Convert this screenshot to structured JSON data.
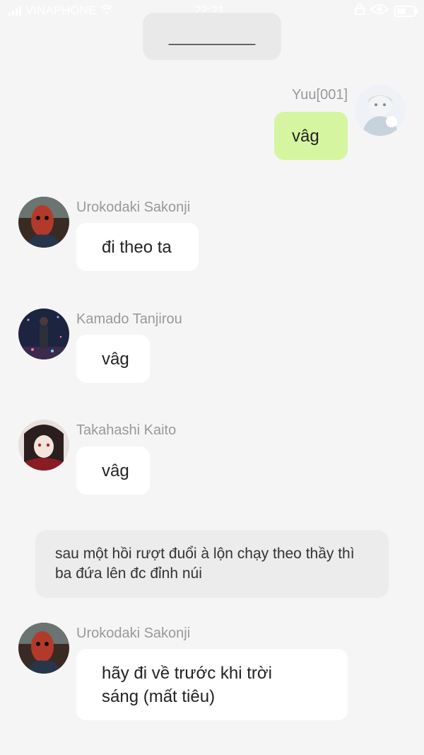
{
  "status_bar": {
    "carrier": "VINAPHONE",
    "time": "22:21"
  },
  "top_banner": {
    "text": "__________"
  },
  "messages": [
    {
      "sender": "Yuu[001]",
      "text": "vâg",
      "self": true
    },
    {
      "sender": "Urokodaki Sakonji",
      "text": "đi theo ta"
    },
    {
      "sender": "Kamado Tanjirou",
      "text": "vâg"
    },
    {
      "sender": "Takahashi Kaito",
      "text": "vâg"
    },
    {
      "sender": "Urokodaki Sakonji",
      "text": "hãy đi về trước khi trời sáng (mất tiêu)"
    }
  ],
  "narration": {
    "text": "sau một hồi rượt đuổi à lộn chạy theo thầy thì ba đứa lên đc đỉnh núi"
  },
  "colors": {
    "background": "#f5f5f5",
    "self_bubble": "#d6f5a0",
    "other_bubble": "#ffffff",
    "narration_bg": "#ececec",
    "name_color": "#999999"
  }
}
